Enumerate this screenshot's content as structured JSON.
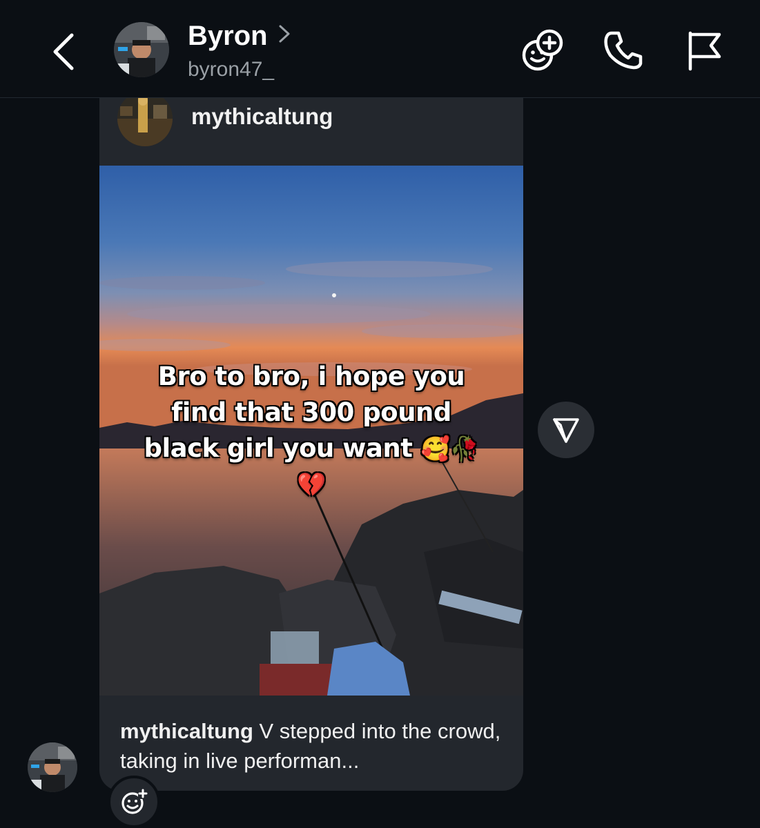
{
  "header": {
    "back_icon": "chevron-left-icon",
    "contact_name": "Byron",
    "contact_handle": "byron47_",
    "name_chevron_icon": "chevron-right-icon",
    "effects_icon": "add-effect-icon",
    "call_icon": "phone-icon",
    "report_icon": "flag-icon"
  },
  "shared_post": {
    "author": "mythicaltung",
    "overlay_text_lines": [
      "Bro to bro, i hope you",
      "find that 300 pound",
      "black girl you want"
    ],
    "overlay_emojis_line3": "🥰🥀",
    "overlay_emoji_line4": "💔",
    "caption_user": "mythicaltung",
    "caption_text": " V stepped into the crowd, taking in live performan..."
  },
  "actions": {
    "share_icon": "send-icon",
    "react_icon": "add-reaction-icon"
  },
  "colors": {
    "background": "#0b0f14",
    "card": "#23272d",
    "muted_text": "#9aa0a6"
  }
}
